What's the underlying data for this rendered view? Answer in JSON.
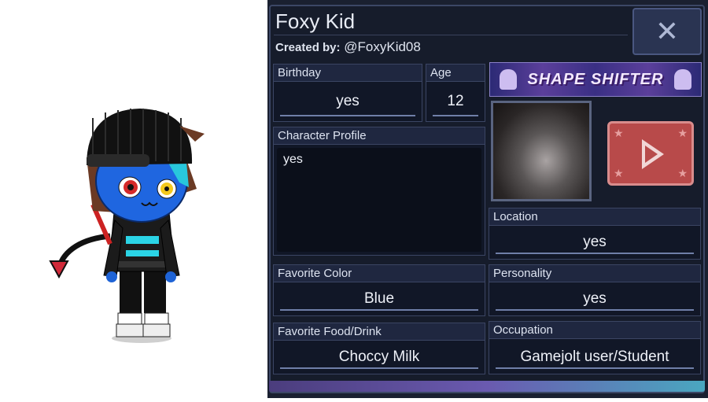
{
  "character": {
    "name": "Foxy Kid",
    "created_by_label": "Created by:",
    "created_by_user": "@FoxyKid08"
  },
  "fields": {
    "birthday": {
      "label": "Birthday",
      "value": "yes"
    },
    "age": {
      "label": "Age",
      "value": "12"
    },
    "profile": {
      "label": "Character Profile",
      "value": "yes"
    },
    "location": {
      "label": "Location",
      "value": "yes"
    },
    "favorite_color": {
      "label": "Favorite Color",
      "value": "Blue"
    },
    "personality": {
      "label": "Personality",
      "value": "yes"
    },
    "favorite_food": {
      "label": "Favorite Food/Drink",
      "value": "Choccy Milk"
    },
    "occupation": {
      "label": "Occupation",
      "value": "Gamejolt user/Student"
    }
  },
  "banner": {
    "text": "SHAPE SHIFTER"
  },
  "icons": {
    "close": "close-icon",
    "play": "play-icon"
  },
  "colors": {
    "panel_bg": "#161c2b",
    "play_button": "#b84a4a",
    "banner": "#5b3f9b"
  }
}
